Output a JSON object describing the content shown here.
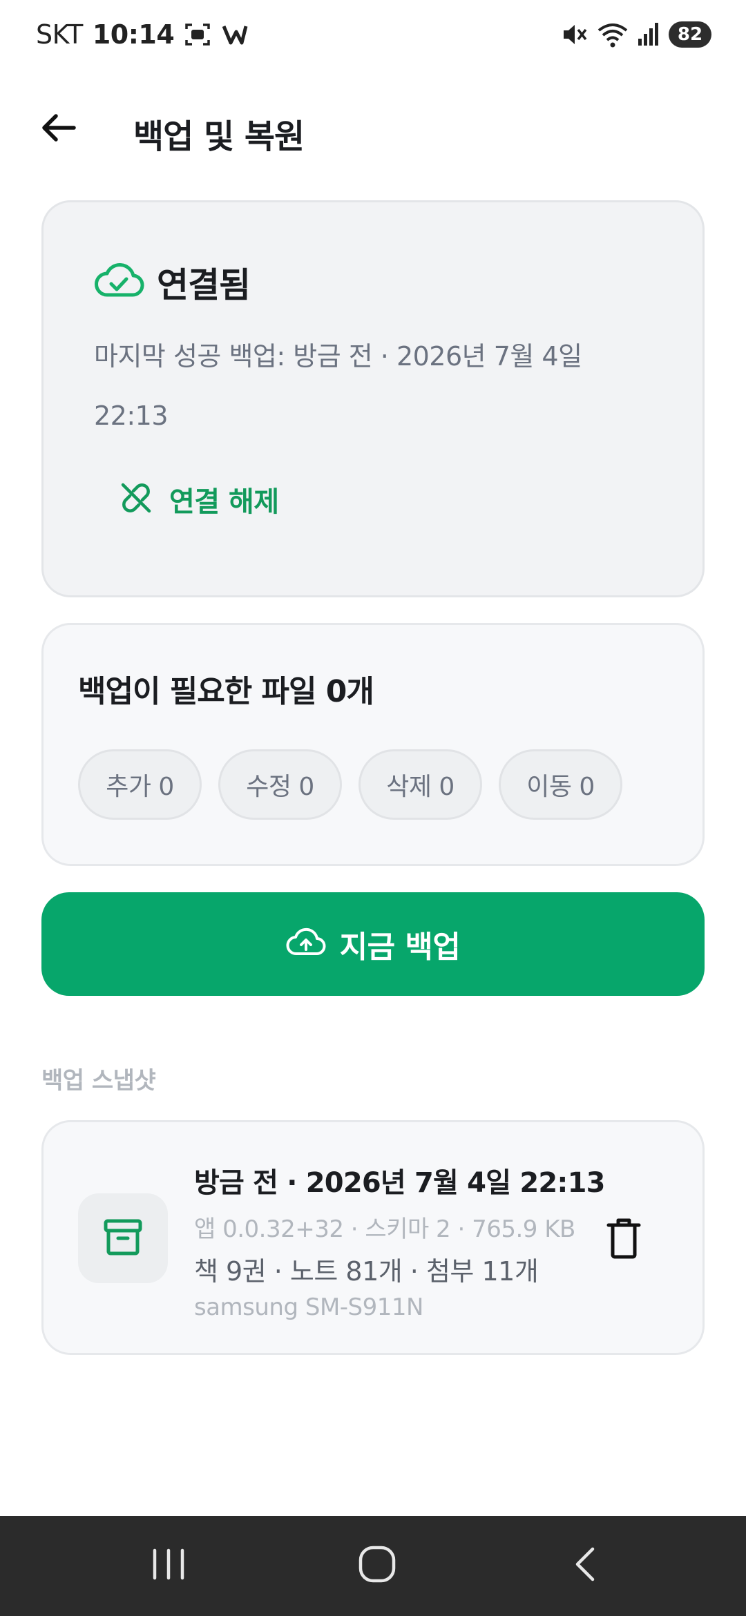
{
  "status_bar": {
    "carrier": "SKT",
    "time": "10:14",
    "battery": "82",
    "icons": [
      "screenshot-icon",
      "app-notification-icon",
      "mute-icon",
      "wifi-icon",
      "signal-icon"
    ]
  },
  "app_bar": {
    "title": "백업 및 복원",
    "back_icon": "arrow-left-icon"
  },
  "connection": {
    "status_icon": "cloud-check-icon",
    "status_label": "연결됨",
    "last_backup": "마지막 성공 백업: 방금 전 · 2026년 7월 4일 22:13",
    "disconnect_icon": "link-off-icon",
    "disconnect_label": "연결 해제"
  },
  "pending": {
    "title": "백업이 필요한 파일 0개",
    "chips": [
      {
        "label": "추가 0"
      },
      {
        "label": "수정 0"
      },
      {
        "label": "삭제 0"
      },
      {
        "label": "이동 0"
      }
    ]
  },
  "backup_button": {
    "icon": "cloud-upload-icon",
    "label": "지금 백업"
  },
  "snapshots": {
    "section_title": "백업 스냅샷",
    "items": [
      {
        "icon": "archive-icon",
        "title": "방금 전 · 2026년 7월 4일 22:13",
        "meta": "앱 0.0.32+32 · 스키마 2 · 765.9 KB",
        "counts": "책 9권 · 노트 81개 · 첨부 11개",
        "device": "samsung SM-S911N",
        "delete_icon": "trash-icon"
      }
    ]
  },
  "nav_bar": {
    "buttons": [
      "recents-icon",
      "home-icon",
      "back-icon"
    ]
  },
  "colors": {
    "accent": "#07a66b",
    "accent_text": "#129a5b",
    "card_bg": "#f2f3f5",
    "muted_text": "#6b7280"
  }
}
